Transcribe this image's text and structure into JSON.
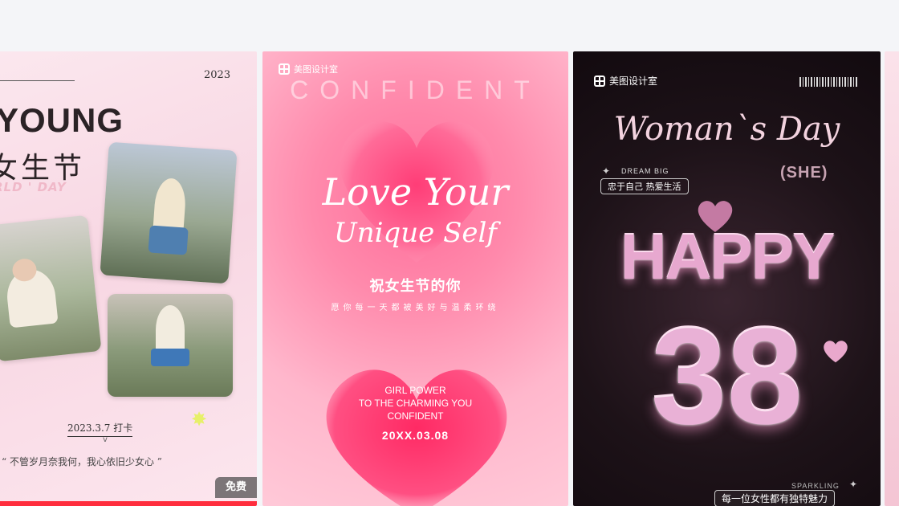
{
  "cards": [
    {
      "year": "2023",
      "title": "YOUNG",
      "subtitle": "女生节",
      "english": "RLD ' DAY",
      "date": "2023.3.7 打卡",
      "caret": "v",
      "quote": "“ 不管岁月奈我何，我心依旧少女心 ”",
      "badge": "免费"
    },
    {
      "brand": "美图设计室",
      "header": "CONFIDENT",
      "headline_line1": "Love Your",
      "headline_line2": "Unique Self",
      "cn_title": "祝女生节的你",
      "cn_sub": "愿你每一天都被美好与温柔环绕",
      "power_lines": [
        "GIRL POWER",
        "TO THE CHARMING YOU",
        "CONFIDENT"
      ],
      "date": "20XX.03.08"
    },
    {
      "brand": "美图设计室",
      "title": "Woman`s Day",
      "dream": "DREAM BIG",
      "tag": "忠于自己 热爱生活",
      "she": "(SHE)",
      "happy": "HAPPY",
      "number": "38",
      "sparkling": "SPARKLING",
      "footer": "每一位女性都有独特魅力"
    }
  ],
  "colors": {
    "accent_red": "#ff2d3d",
    "pink": "#ff6d9a",
    "dark": "#1d1218"
  }
}
